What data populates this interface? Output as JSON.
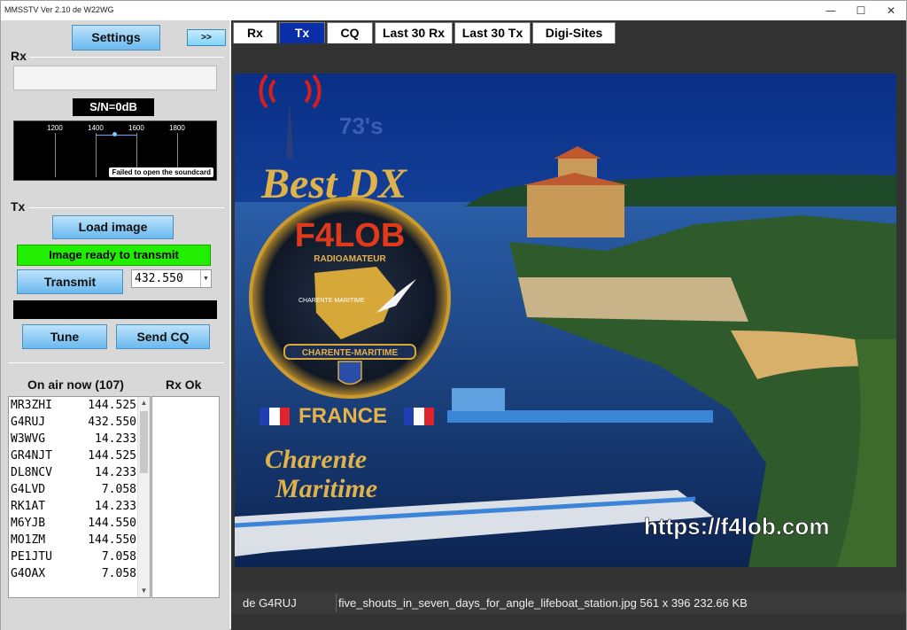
{
  "window": {
    "title": "MMSSTV  Ver 2.10 de W22WG",
    "min_icon": "—",
    "max_icon": "☐",
    "close_icon": "✕"
  },
  "left": {
    "settings_label": "Settings",
    "expand_label": ">>",
    "rx_label": "Rx",
    "snr": "S/N=0dB",
    "ticks": [
      "1200",
      "1400",
      "1600",
      "1800"
    ],
    "soundcard_msg": "Failed to open the soundcard",
    "tx_label": "Tx",
    "load_image_label": "Load image",
    "status": "Image ready to transmit",
    "transmit_label": "Transmit",
    "frequency": "432.550",
    "tune_label": "Tune",
    "send_cq_label": "Send CQ",
    "on_air_header": "On air now (107)",
    "rx_ok_header": "Rx Ok",
    "stations": [
      {
        "call": "MR3ZHI",
        "freq": "144.525"
      },
      {
        "call": "G4RUJ",
        "freq": "432.550"
      },
      {
        "call": "W3WVG",
        "freq": "14.233"
      },
      {
        "call": "GR4NJT",
        "freq": "144.525"
      },
      {
        "call": "DL8NCV",
        "freq": "14.233"
      },
      {
        "call": "G4LVD",
        "freq": "7.058"
      },
      {
        "call": "RK1AT",
        "freq": "14.233"
      },
      {
        "call": "M6YJB",
        "freq": "144.550"
      },
      {
        "call": "MO1ZM",
        "freq": "144.550"
      },
      {
        "call": "PE1JTU",
        "freq": "7.058"
      },
      {
        "call": "G4OAX",
        "freq": "7.058"
      }
    ]
  },
  "tabs": [
    {
      "label": "Rx",
      "active": false
    },
    {
      "label": "Tx",
      "active": true
    },
    {
      "label": "CQ",
      "active": false
    },
    {
      "label": "Last 30 Rx",
      "active": false
    },
    {
      "label": "Last 30 Tx",
      "active": false
    },
    {
      "label": "Digi-Sites",
      "active": false
    }
  ],
  "image": {
    "tagline": "73's",
    "best_dx": "Best DX",
    "callsign": "F4LOB",
    "radioamateur": "RADIOAMATEUR",
    "region_small": "CHARENTE MARITIME",
    "ribbon": "CHARENTE-MARITIME",
    "country": "FRANCE",
    "region_line1": "Charente",
    "region_line2": "Maritime",
    "url": "https://f4lob.com"
  },
  "bottom": {
    "de": "de G4RUJ",
    "file_info": "five_shouts_in_seven_days_for_angle_lifeboat_station.jpg   561 x 396   232.66 KB"
  }
}
